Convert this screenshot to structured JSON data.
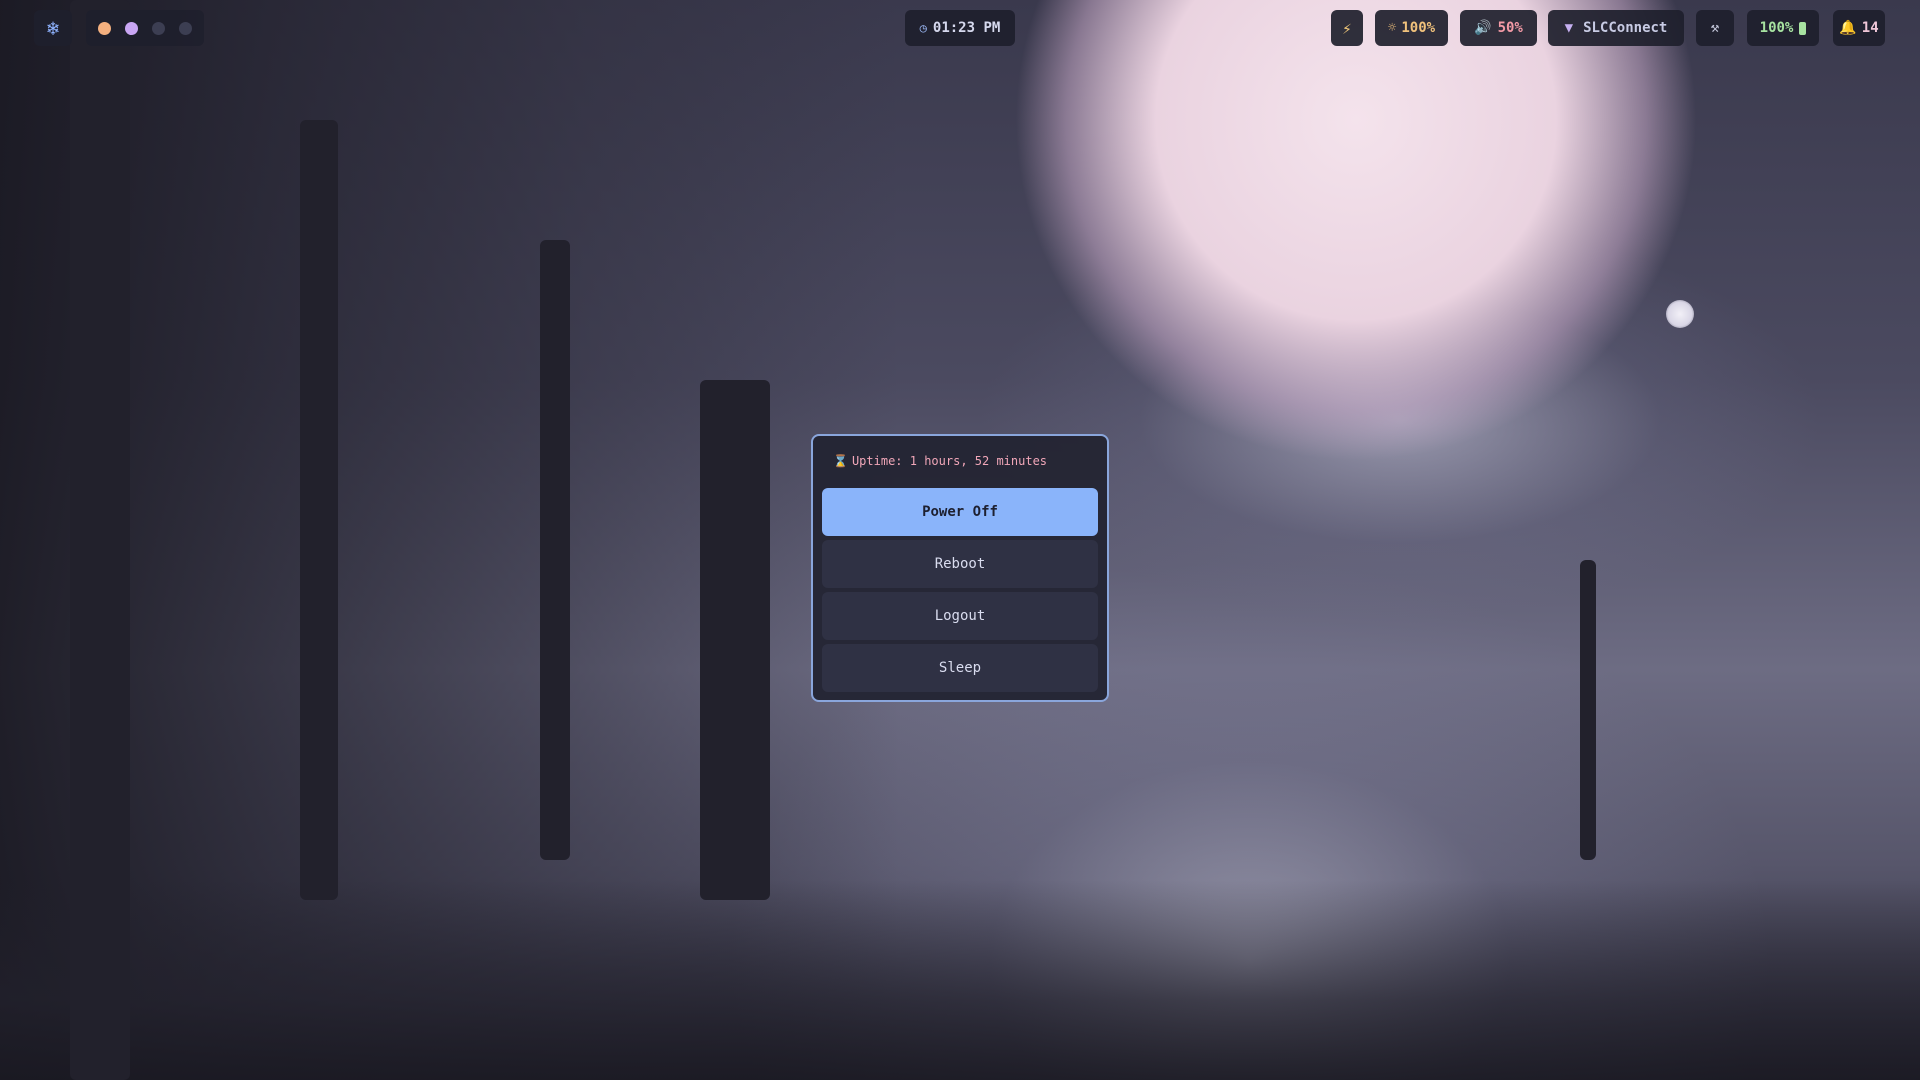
{
  "topbar": {
    "launcher_icon": "snowflake-icon",
    "workspaces": [
      {
        "color": "#f4b07f",
        "active": true
      },
      {
        "color": "#c9a6f4",
        "active": true
      },
      {
        "color": "#3c3e52",
        "active": false
      },
      {
        "color": "#3c3e52",
        "active": false
      }
    ],
    "clock": {
      "icon": "clock-icon",
      "time": "01:23 PM"
    },
    "power_profile_icon": "bolt-icon",
    "brightness": {
      "icon": "sun-icon",
      "value": "100%"
    },
    "volume": {
      "icon": "speaker-icon",
      "value": "50%"
    },
    "network": {
      "icon": "wifi-icon",
      "ssid": "SLCConnect"
    },
    "tools_icon": "tools-icon",
    "battery": {
      "value": "100%",
      "icon": "battery-icon"
    },
    "notifications": {
      "icon": "bell-icon",
      "count": "14"
    }
  },
  "power_menu": {
    "uptime_icon": "hourglass-icon",
    "uptime": "Uptime: 1 hours, 52 minutes",
    "buttons": [
      {
        "label": "Power Off",
        "selected": true
      },
      {
        "label": "Reboot",
        "selected": false
      },
      {
        "label": "Logout",
        "selected": false
      },
      {
        "label": "Sleep",
        "selected": false
      }
    ]
  },
  "colors": {
    "accent": "#8ab4fa",
    "border": "#8aa6dc",
    "uptime_text": "#f0a6b8",
    "bar_bg": "#1e1f2c"
  }
}
